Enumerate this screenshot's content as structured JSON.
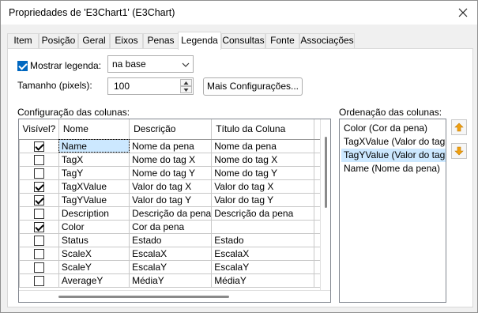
{
  "window": {
    "title": "Propriedades de 'E3Chart1' (E3Chart)"
  },
  "tabs": [
    {
      "label": "Item"
    },
    {
      "label": "Posição"
    },
    {
      "label": "Geral"
    },
    {
      "label": "Eixos"
    },
    {
      "label": "Penas"
    },
    {
      "label": "Legenda"
    },
    {
      "label": "Consultas"
    },
    {
      "label": "Fonte"
    },
    {
      "label": "Associações"
    }
  ],
  "active_tab": "Legenda",
  "legend": {
    "show_label": "Mostrar legenda:",
    "show_checked": true,
    "position_value": "na base",
    "size_label": "Tamanho (pixels):",
    "size_value": "100",
    "more_button": "Mais Configurações..."
  },
  "columns_config": {
    "title": "Configuração das colunas:",
    "headers": [
      "Visível?",
      "Nome",
      "Descrição",
      "Título da Coluna"
    ],
    "rows": [
      {
        "visible": true,
        "name": "Name",
        "description": "Nome da pena",
        "title": "Nome da pena"
      },
      {
        "visible": false,
        "name": "TagX",
        "description": "Nome do tag X",
        "title": "Nome do tag X"
      },
      {
        "visible": false,
        "name": "TagY",
        "description": "Nome do tag Y",
        "title": "Nome do tag Y"
      },
      {
        "visible": true,
        "name": "TagXValue",
        "description": "Valor do tag X",
        "title": "Valor do tag X"
      },
      {
        "visible": true,
        "name": "TagYValue",
        "description": "Valor do tag Y",
        "title": "Valor do tag Y"
      },
      {
        "visible": false,
        "name": "Description",
        "description": "Descrição da pena",
        "title": "Descrição da pena"
      },
      {
        "visible": true,
        "name": "Color",
        "description": "Cor da pena",
        "title": ""
      },
      {
        "visible": false,
        "name": "Status",
        "description": "Estado",
        "title": "Estado"
      },
      {
        "visible": false,
        "name": "ScaleX",
        "description": "EscalaX",
        "title": "EscalaX"
      },
      {
        "visible": false,
        "name": "ScaleY",
        "description": "EscalaY",
        "title": "EscalaY"
      },
      {
        "visible": false,
        "name": "AverageY",
        "description": "MédiaY",
        "title": "MédiaY"
      }
    ]
  },
  "columns_order": {
    "title": "Ordenação das colunas:",
    "items": [
      "Color (Cor da pena)",
      "TagXValue (Valor do tag X)",
      "TagYValue (Valor do tag Y)",
      "Name (Nome da pena)"
    ],
    "selected_index": 2
  },
  "icons": {
    "move_up": "arrow-up-icon",
    "move_down": "arrow-down-icon",
    "close": "close-icon"
  },
  "colors": {
    "accent": "#0067c0",
    "selection": "#cce8ff",
    "arrow": "#f0a010"
  }
}
